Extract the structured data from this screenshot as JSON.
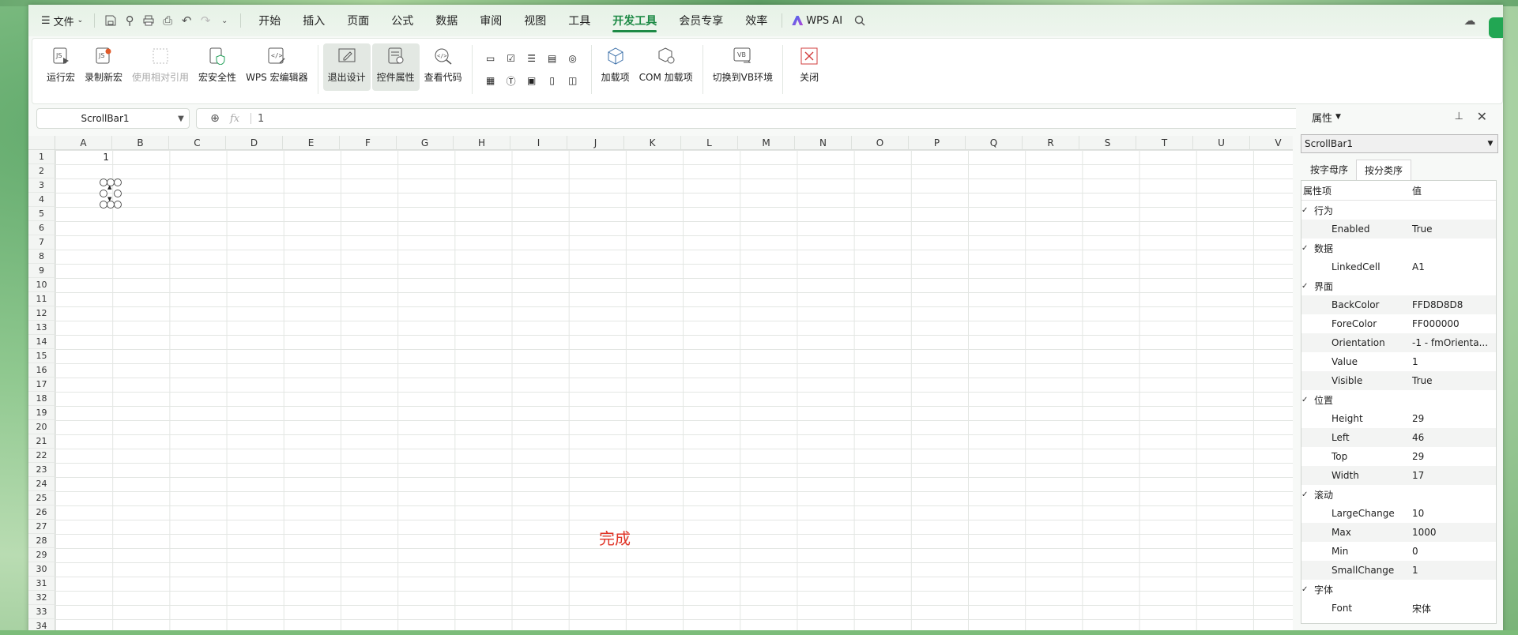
{
  "menubar": {
    "file_label": "文件",
    "tabs": [
      "开始",
      "插入",
      "页面",
      "公式",
      "数据",
      "审阅",
      "视图",
      "工具",
      "开发工具",
      "会员专享",
      "效率"
    ],
    "active_tab": "开发工具",
    "ai_label": "WPS AI"
  },
  "ribbon": {
    "buttons": {
      "run_macro": "运行宏",
      "record_macro": "录制新宏",
      "relative_ref": "使用相对引用",
      "macro_security": "宏安全性",
      "wps_macro_editor": "WPS 宏编辑器",
      "exit_design": "退出设计",
      "control_props": "控件属性",
      "view_code": "查看代码",
      "addins": "加载项",
      "com_addins": "COM 加载项",
      "switch_vb": "切换到VB环境",
      "close": "关闭"
    }
  },
  "formula_bar": {
    "name_box": "ScrollBar1",
    "fx": "fx",
    "value": "1"
  },
  "sheet": {
    "columns": [
      "A",
      "B",
      "C",
      "D",
      "E",
      "F",
      "G",
      "H",
      "I",
      "J",
      "K",
      "L",
      "M",
      "N",
      "O",
      "P",
      "Q",
      "R",
      "S",
      "T",
      "U",
      "V"
    ],
    "rows": [
      "1",
      "2",
      "3",
      "4",
      "5",
      "6",
      "7",
      "8",
      "9",
      "10",
      "11",
      "12",
      "13",
      "14",
      "15",
      "16",
      "17",
      "18",
      "19",
      "20",
      "21",
      "22",
      "23",
      "24",
      "25",
      "26",
      "27",
      "28",
      "29",
      "30",
      "31",
      "32",
      "33",
      "34"
    ],
    "cell_a1": "1",
    "overlay_text": "完成"
  },
  "properties": {
    "title": "属性",
    "object": "ScrollBar1",
    "tabs": [
      "按字母序",
      "按分类序"
    ],
    "active_tab": "按分类序",
    "col_key": "属性项",
    "col_value": "值",
    "rows": [
      {
        "type": "cat",
        "k": "行为"
      },
      {
        "type": "prop",
        "k": "Enabled",
        "v": "True"
      },
      {
        "type": "cat",
        "k": "数据"
      },
      {
        "type": "prop",
        "k": "LinkedCell",
        "v": "A1"
      },
      {
        "type": "cat",
        "k": "界面"
      },
      {
        "type": "prop",
        "k": "BackColor",
        "v": "FFD8D8D8"
      },
      {
        "type": "prop",
        "k": "ForeColor",
        "v": "FF000000"
      },
      {
        "type": "prop",
        "k": "Orientation",
        "v": "-1 - fmOrienta..."
      },
      {
        "type": "prop",
        "k": "Value",
        "v": "1"
      },
      {
        "type": "prop",
        "k": "Visible",
        "v": "True"
      },
      {
        "type": "cat",
        "k": "位置"
      },
      {
        "type": "prop",
        "k": "Height",
        "v": "29"
      },
      {
        "type": "prop",
        "k": "Left",
        "v": "46"
      },
      {
        "type": "prop",
        "k": "Top",
        "v": "29"
      },
      {
        "type": "prop",
        "k": "Width",
        "v": "17"
      },
      {
        "type": "cat",
        "k": "滚动"
      },
      {
        "type": "prop",
        "k": "LargeChange",
        "v": "10"
      },
      {
        "type": "prop",
        "k": "Max",
        "v": "1000"
      },
      {
        "type": "prop",
        "k": "Min",
        "v": "0"
      },
      {
        "type": "prop",
        "k": "SmallChange",
        "v": "1"
      },
      {
        "type": "cat",
        "k": "字体"
      },
      {
        "type": "prop",
        "k": "Font",
        "v": "宋体"
      }
    ]
  }
}
